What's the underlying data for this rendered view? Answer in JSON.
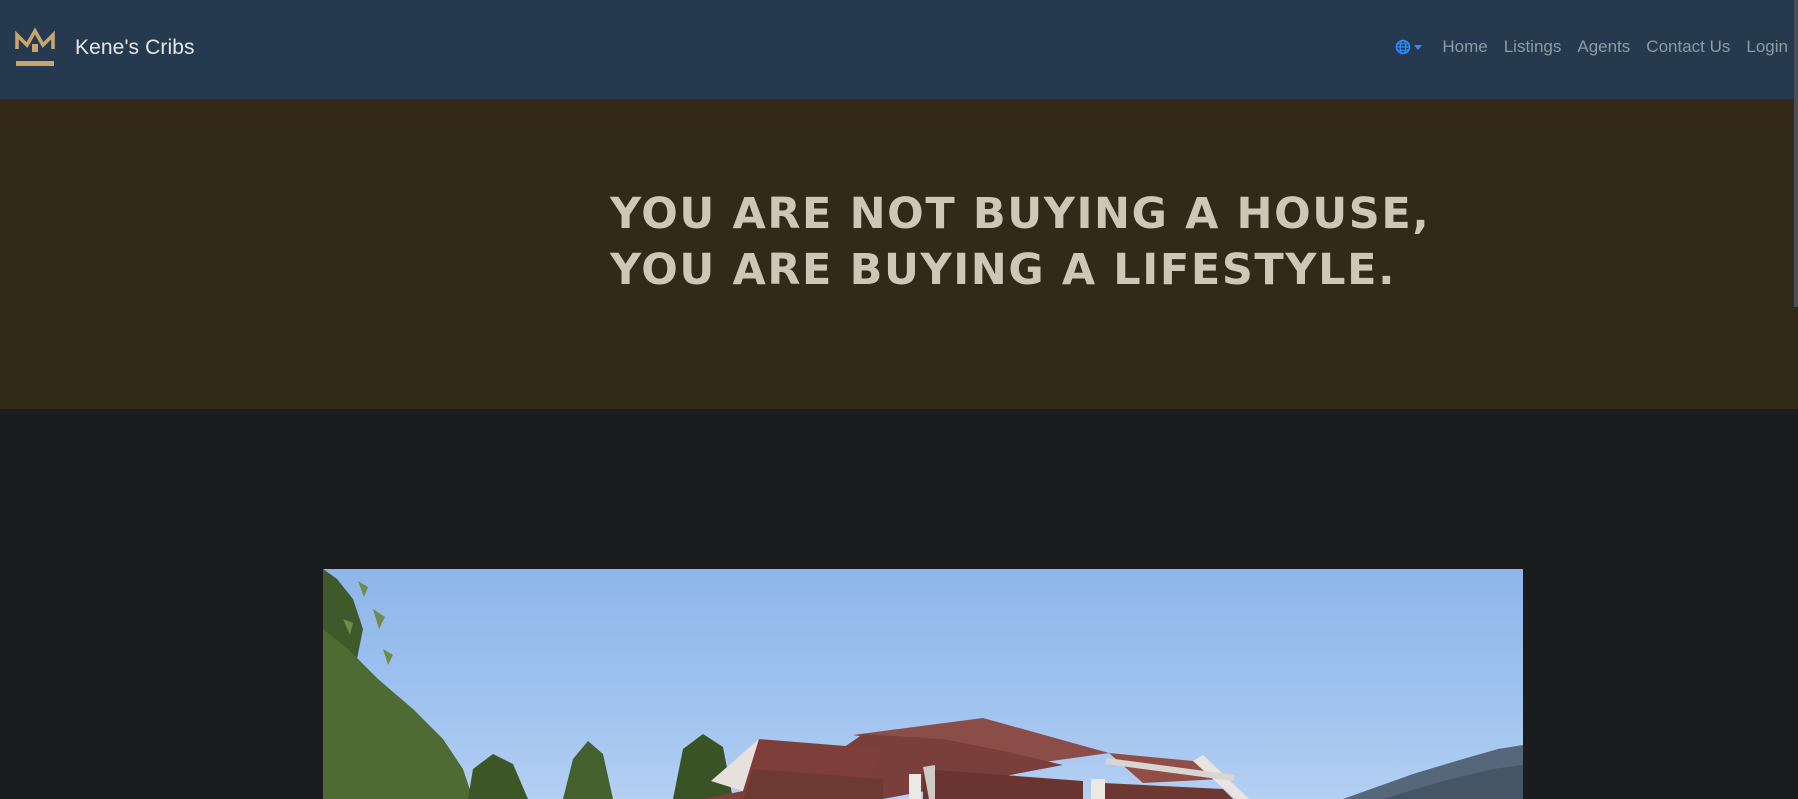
{
  "brand": {
    "name": "Kene's Cribs",
    "accent_color": "#c9a46e"
  },
  "nav": {
    "language_icon": "globe-icon",
    "links": [
      "Home",
      "Listings",
      "Agents",
      "Contact Us",
      "Login"
    ]
  },
  "hero": {
    "line1": "YOU ARE NOT BUYING A HOUSE,",
    "line2": "YOU ARE BUYING A LIFESTYLE."
  },
  "colors": {
    "navbar": "#253a4e",
    "hero_background": "#332918",
    "page_background": "#1b1c1e",
    "hero_text": "#cfc6b8",
    "link": "#8f9aa5",
    "language_toggle": "#2b8cff"
  }
}
